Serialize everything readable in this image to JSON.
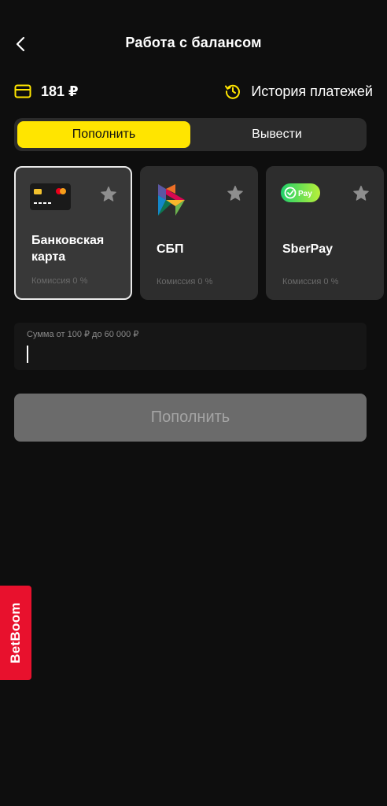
{
  "header": {
    "title": "Работа с балансом",
    "back_icon": "chevron-left-icon"
  },
  "balance": {
    "amount": "181 ₽",
    "icon": "wallet-icon",
    "accent_color": "#ffe500"
  },
  "history": {
    "label": "История платежей",
    "icon": "history-icon"
  },
  "tabs": [
    {
      "label": "Пополнить",
      "active": true
    },
    {
      "label": "Вывести",
      "active": false
    }
  ],
  "methods": [
    {
      "name": "Банковская карта",
      "commission": "Комиссия 0 %",
      "icon": "bank-card-icon",
      "selected": true
    },
    {
      "name": "СБП",
      "commission": "Комиссия 0 %",
      "icon": "sbp-logo-icon",
      "selected": false
    },
    {
      "name": "SberPay",
      "commission": "Комиссия 0 %",
      "icon": "sberpay-logo-icon",
      "selected": false
    }
  ],
  "amount": {
    "label": "Сумма от 100 ₽ до 60 000 ₽",
    "value": ""
  },
  "submit": {
    "label": "Пополнить"
  },
  "brand": {
    "label": "BetBoom",
    "color": "#e8112d"
  }
}
